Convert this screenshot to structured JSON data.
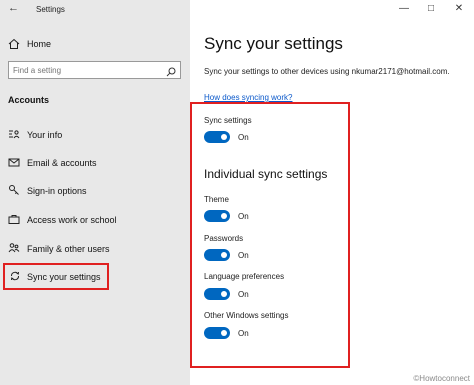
{
  "window": {
    "app_title": "Settings",
    "back_icon": "back-arrow-icon",
    "minimize_icon": "minimize-icon",
    "maximize_icon": "maximize-icon",
    "close_icon": "close-icon"
  },
  "sidebar": {
    "home_label": "Home",
    "search_placeholder": "Find a setting",
    "section_heading": "Accounts",
    "items": [
      {
        "label": "Your info",
        "icon": "person-card-icon"
      },
      {
        "label": "Email & accounts",
        "icon": "mail-icon"
      },
      {
        "label": "Sign-in options",
        "icon": "key-icon"
      },
      {
        "label": "Access work or school",
        "icon": "briefcase-icon"
      },
      {
        "label": "Family & other users",
        "icon": "people-icon"
      },
      {
        "label": "Sync your settings",
        "icon": "sync-icon",
        "selected": true
      }
    ]
  },
  "main": {
    "title": "Sync your settings",
    "description": "Sync your settings to other devices using nkumar2171@hotmail.com.",
    "help_link": "How does syncing work?",
    "sync_settings": {
      "label": "Sync settings",
      "state": "On"
    },
    "individual_heading": "Individual sync settings",
    "toggles": [
      {
        "label": "Theme",
        "state": "On"
      },
      {
        "label": "Passwords",
        "state": "On"
      },
      {
        "label": "Language preferences",
        "state": "On"
      },
      {
        "label": "Other Windows settings",
        "state": "On"
      }
    ]
  },
  "watermark": "©Howtoconnect",
  "colors": {
    "accent": "#0067c0",
    "highlight": "#e02020",
    "sidebar_bg": "#e8e8e8"
  }
}
